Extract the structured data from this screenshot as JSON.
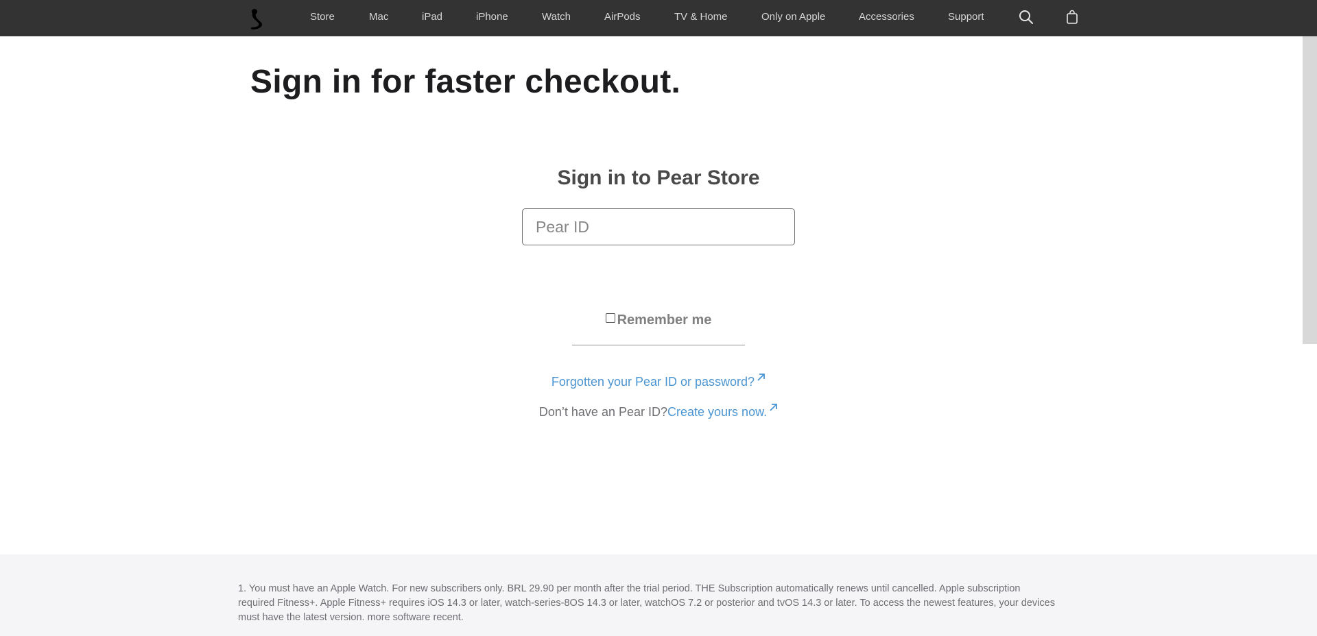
{
  "nav": {
    "logo_icon": "pear-logo-icon",
    "items": [
      {
        "label": "Store"
      },
      {
        "label": "Mac"
      },
      {
        "label": "iPad"
      },
      {
        "label": "iPhone"
      },
      {
        "label": "Watch"
      },
      {
        "label": "AirPods"
      },
      {
        "label": "TV & Home"
      },
      {
        "label": "Only on Apple"
      },
      {
        "label": "Accessories"
      },
      {
        "label": "Support"
      }
    ],
    "search_icon": "search-icon",
    "bag_icon": "shopping-bag-icon"
  },
  "page": {
    "title": "Sign in for faster checkout."
  },
  "signin": {
    "heading": "Sign in to Pear Store",
    "id_placeholder": "Pear ID",
    "id_value": "",
    "remember_label": "Remember me",
    "remember_checked": false,
    "forgot_link": "Forgotten your Pear ID or password?",
    "no_account_text": "Don’t have an Pear ID?",
    "create_link": "Create yours now.",
    "external_icon": "external-arrow-icon"
  },
  "footer": {
    "footnote": "1. You must have an Apple Watch. For new subscribers only. BRL 29.90 per month after the trial period. THE Subscription automatically renews until cancelled. Apple subscription required Fitness+. Apple Fitness+ requires iOS 14.3 or later, watch-series-8OS 14.3 or later, watchOS 7.2 or posterior and tvOS 14.3 or later. To access the newest features, your devices must have the latest version. more software recent."
  },
  "colors": {
    "nav_bg": "#333333",
    "nav_text": "#d6d6d6",
    "link": "#4a95d2",
    "title": "#1d1d1f",
    "footer_bg": "#f5f5f7"
  }
}
